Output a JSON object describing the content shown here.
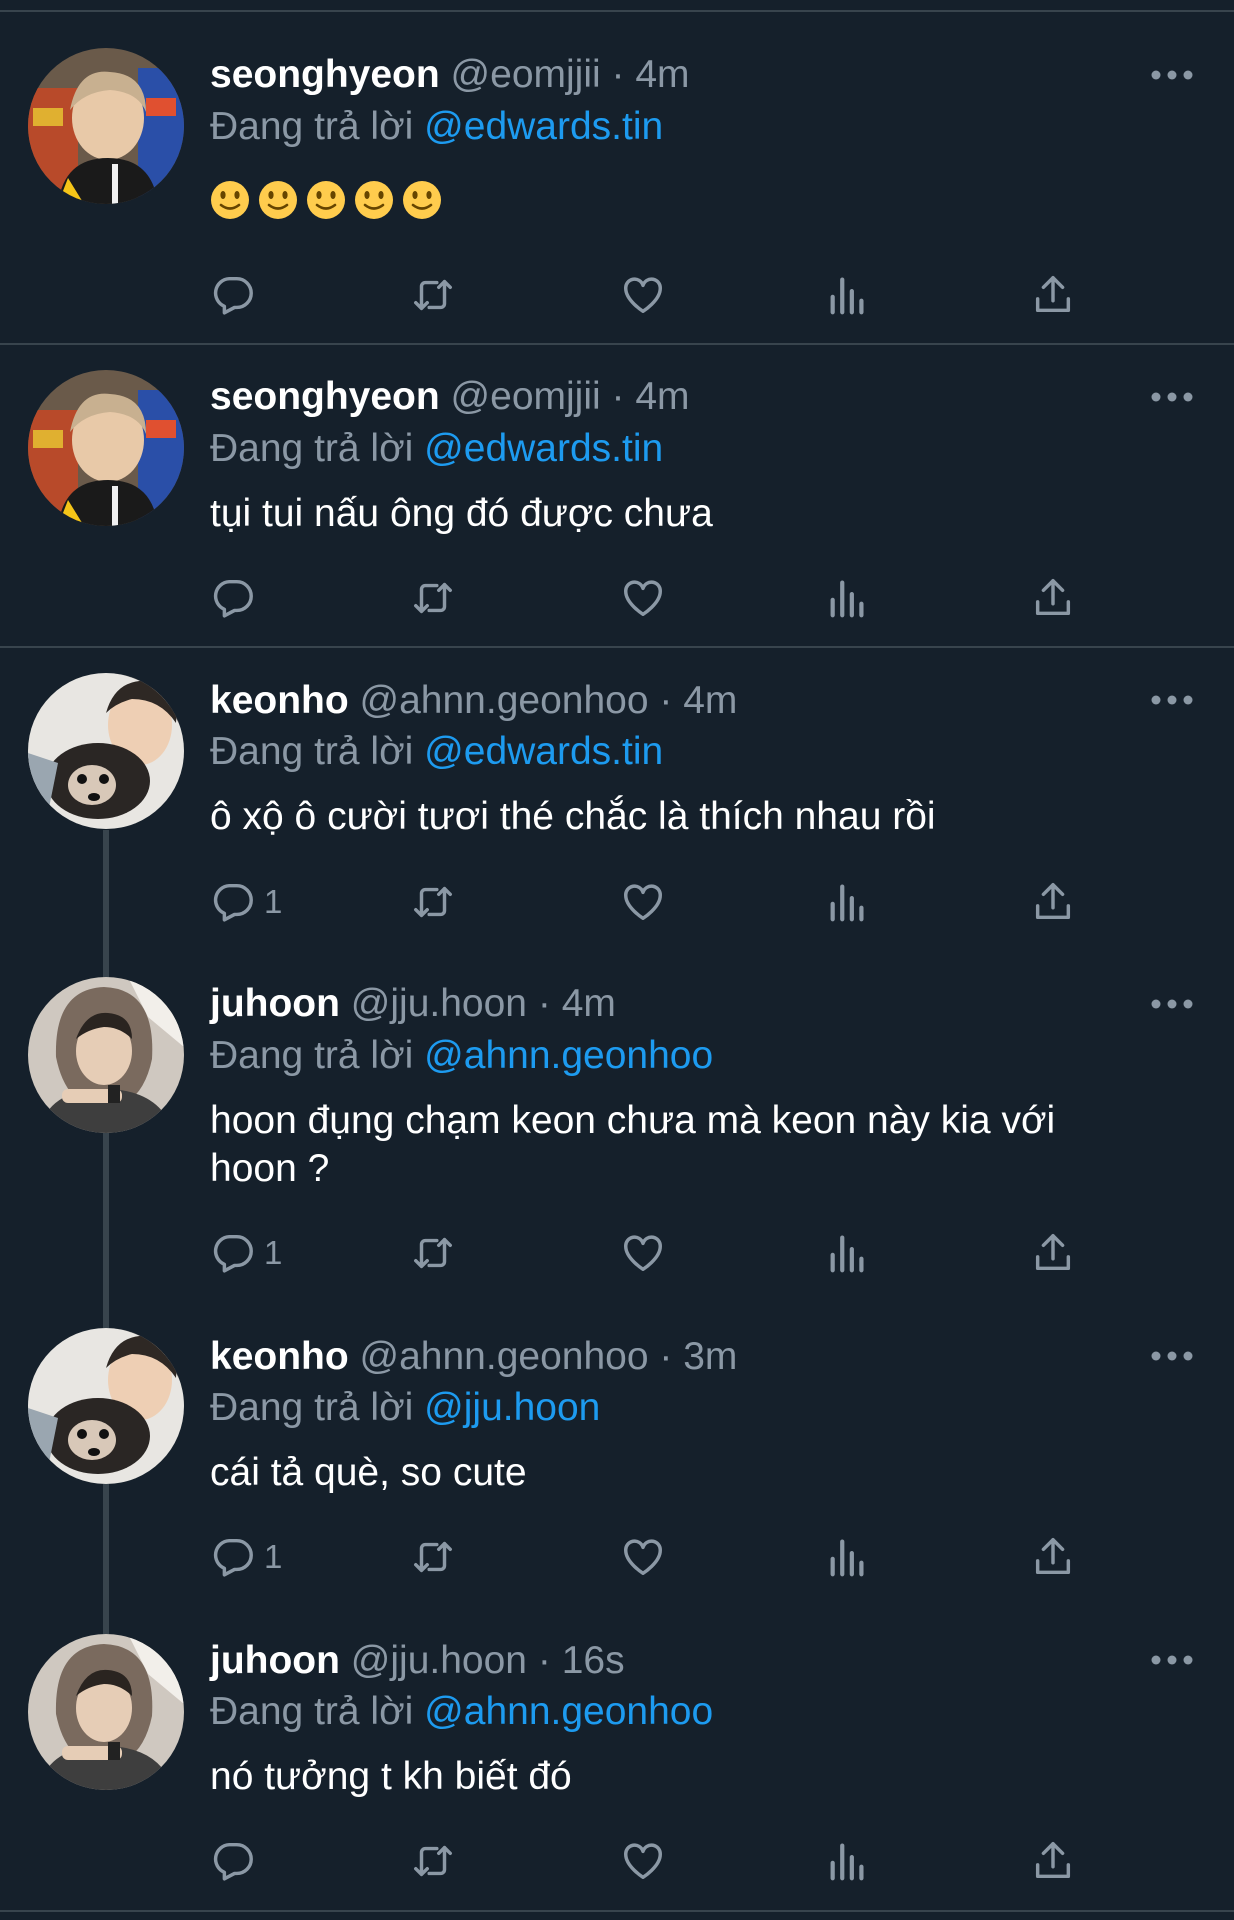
{
  "reply_prefix": "Đang trả lời",
  "tweets": [
    {
      "name": "seonghyeon",
      "handle": "@eomjjii",
      "time": "4m",
      "reply_to": "@edwards.tin",
      "text": "",
      "emoji": [
        "slightly-smiling-face",
        "slightly-smiling-face",
        "slightly-smiling-face",
        "slightly-smiling-face",
        "slightly-smiling-face"
      ],
      "reply_count": ""
    },
    {
      "name": "seonghyeon",
      "handle": "@eomjjii",
      "time": "4m",
      "reply_to": "@edwards.tin",
      "text": "tụi tui nấu ông đó được chưa",
      "reply_count": ""
    },
    {
      "name": "keonho",
      "handle": "@ahnn.geonhoo",
      "time": "4m",
      "reply_to": "@edwards.tin",
      "text": "ô xộ ô cười tươi thé chắc là thích nhau rồi",
      "reply_count": "1"
    },
    {
      "name": "juhoon",
      "handle": "@jju.hoon",
      "time": "4m",
      "reply_to": "@ahnn.geonhoo",
      "text": "hoon đụng chạm keon chưa mà keon này kia với hoon ?",
      "reply_count": "1"
    },
    {
      "name": "keonho",
      "handle": "@ahnn.geonhoo",
      "time": "3m",
      "reply_to": "@jju.hoon",
      "text": "cái tả què, so cute",
      "reply_count": "1"
    },
    {
      "name": "juhoon",
      "handle": "@jju.hoon",
      "time": "16s",
      "reply_to": "@ahnn.geonhoo",
      "text": "nó tưởng t kh biết đó",
      "reply_count": ""
    }
  ],
  "icons": {
    "reply": "reply-icon",
    "retweet": "retweet-icon",
    "like": "heart-icon",
    "views": "views-icon",
    "share": "share-icon",
    "more": "more-icon"
  },
  "colors": {
    "background": "#15202b",
    "mention": "#1d9bf0",
    "secondary_text": "#8b98a5",
    "divider": "#38444d"
  }
}
